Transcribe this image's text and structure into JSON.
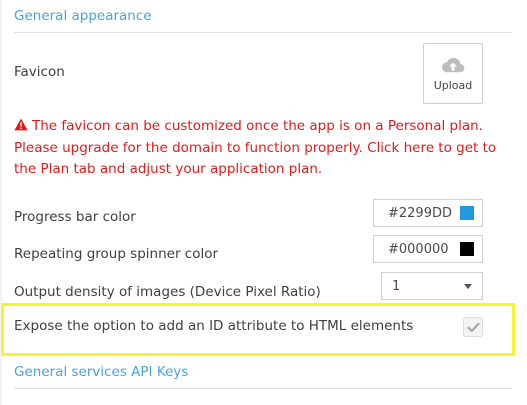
{
  "general_appearance": {
    "header": "General appearance",
    "favicon": {
      "label": "Favicon",
      "upload_label": "Upload",
      "upload_icon": "cloud-upload-icon"
    },
    "warning": {
      "icon": "warning-icon",
      "text": "The favicon can be customized once the app is on a Personal plan. Please upgrade for the domain to function properly. Click here to get to the Plan tab and adjust your application plan.",
      "color": "#E11B1B"
    },
    "progress_bar_color": {
      "label": "Progress bar color",
      "value": "#2299DD",
      "swatch": "#2299DD"
    },
    "spinner_color": {
      "label": "Repeating group spinner color",
      "value": "#000000",
      "swatch": "#000000"
    },
    "output_density": {
      "label": "Output density of images (Device Pixel Ratio)",
      "selected": "1"
    },
    "expose_id_attribute": {
      "label": "Expose the option to add an ID attribute to HTML elements",
      "checked": true
    }
  },
  "next_section": {
    "header": "General services API Keys"
  },
  "colors": {
    "accent": "#4AA3DF",
    "highlight": "#F4F430"
  }
}
